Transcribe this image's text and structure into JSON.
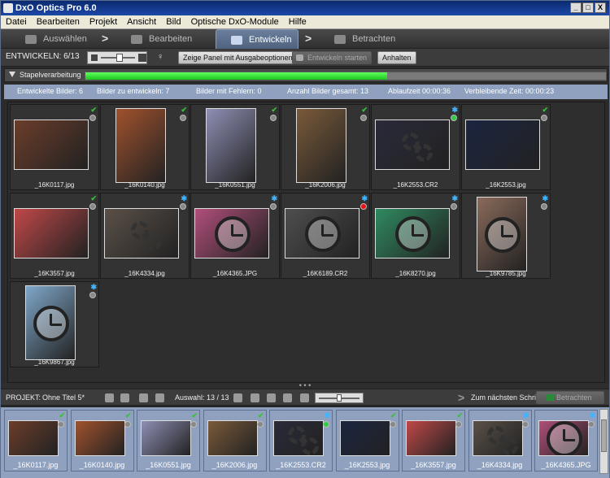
{
  "window": {
    "title": "DxO Optics Pro 6.0",
    "min": "_",
    "max": "□",
    "close": "X"
  },
  "menu": [
    "Datei",
    "Bearbeiten",
    "Projekt",
    "Ansicht",
    "Bild",
    "Optische DxO-Module",
    "Hilfe"
  ],
  "steps": [
    {
      "label": "Auswählen",
      "active": false
    },
    {
      "label": "Bearbeiten",
      "active": false
    },
    {
      "label": "Entwickeln",
      "active": true
    },
    {
      "label": "Betrachten",
      "active": false
    }
  ],
  "step_chevron": ">",
  "toolbar": {
    "develop_label": "ENTWICKELN: 6/13",
    "show_panel_button": "Zeige Panel mit Ausgabeoptionen",
    "start_button": "Entwickeln starten",
    "stop_button": "Anhalten"
  },
  "batch": {
    "label": "Stapelverarbeitung",
    "progress": 0.58
  },
  "stats": {
    "developed": "Entwickelte Bilder: 6",
    "to_develop": "Bilder zu entwickeln: 7",
    "errors": "Bilder mit Fehlern: 0",
    "total": "Anzahl Bilder gesamt: 13",
    "elapsed": "Ablaufzeit 00:00:36",
    "remaining": "Verbleibende Zeit: 00:00:23"
  },
  "images": [
    {
      "name": "_16K0117.jpg",
      "status": "done",
      "overlay": "none",
      "color": "#6b3d2a"
    },
    {
      "name": "_16K0140.jpg",
      "status": "done",
      "overlay": "none",
      "color": "#a0522d"
    },
    {
      "name": "_16K0551.jpg",
      "status": "done",
      "overlay": "none",
      "color": "#8e8fb4"
    },
    {
      "name": "_16K2006.jpg",
      "status": "done",
      "overlay": "none",
      "color": "#7a5a3a"
    },
    {
      "name": "_16K2553.CR2",
      "status": "processing",
      "overlay": "gear",
      "color": "#2a2a3a"
    },
    {
      "name": "_16K2553.jpg",
      "status": "done",
      "overlay": "none",
      "color": "#1b2540"
    },
    {
      "name": "_16K3557.jpg",
      "status": "done",
      "overlay": "none",
      "color": "#c04848"
    },
    {
      "name": "_16K4334.jpg",
      "status": "queued",
      "overlay": "gear",
      "color": "#5a5048"
    },
    {
      "name": "_16K4365.JPG",
      "status": "queued",
      "overlay": "clock",
      "color": "#b04f7a"
    },
    {
      "name": "_16K6189.CR2",
      "status": "error",
      "overlay": "clock",
      "color": "#4e4e4e"
    },
    {
      "name": "_16K8270.jpg",
      "status": "queued",
      "overlay": "clock",
      "color": "#2f8a60"
    },
    {
      "name": "_16K9785.jpg",
      "status": "queued",
      "overlay": "clock",
      "color": "#8a6a5a"
    },
    {
      "name": "_16K9867.jpg",
      "status": "queued",
      "overlay": "clock",
      "color": "#7fa7c9"
    }
  ],
  "project": {
    "label": "PROJEKT:",
    "name": "Ohne Titel 5*",
    "selection": "Auswahl: 13 / 13",
    "next_step": "Zum nächsten Schritt",
    "view_button": "Betrachten"
  },
  "filmstrip": [
    {
      "name": "_16K0117.jpg",
      "status": "done",
      "overlay": "none",
      "color": "#6b3d2a"
    },
    {
      "name": "_16K0140.jpg",
      "status": "done",
      "overlay": "none",
      "color": "#a0522d"
    },
    {
      "name": "_16K0551.jpg",
      "status": "done",
      "overlay": "none",
      "color": "#8e8fb4"
    },
    {
      "name": "_16K2006.jpg",
      "status": "done",
      "overlay": "none",
      "color": "#7a5a3a"
    },
    {
      "name": "_16K2553.CR2",
      "status": "processing",
      "overlay": "gear",
      "color": "#2a2a3a"
    },
    {
      "name": "_16K2553.jpg",
      "status": "done",
      "overlay": "none",
      "color": "#1b2540"
    },
    {
      "name": "_16K3557.jpg",
      "status": "done",
      "overlay": "none",
      "color": "#c04848"
    },
    {
      "name": "_16K4334.jpg",
      "status": "queued",
      "overlay": "gear",
      "color": "#5a5048"
    },
    {
      "name": "_16K4365.JPG",
      "status": "queued",
      "overlay": "clock",
      "color": "#b04f7a"
    }
  ],
  "splitter_dots": "• • •"
}
